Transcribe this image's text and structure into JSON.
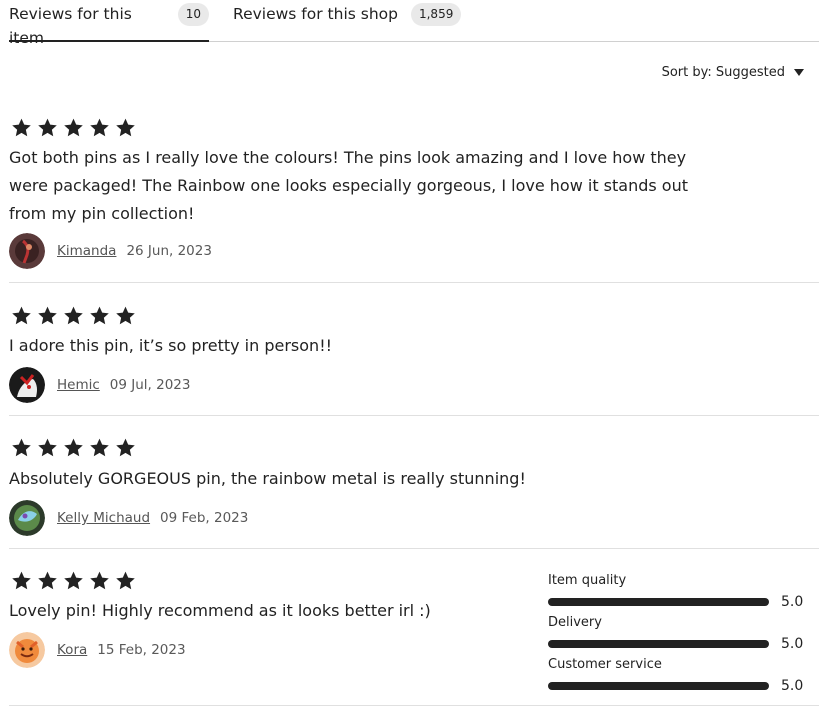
{
  "tabs": [
    {
      "label": "Reviews for this item",
      "count": "10",
      "active": true
    },
    {
      "label": "Reviews for this shop",
      "count": "1,859",
      "active": false
    }
  ],
  "sort": {
    "label": "Sort by: Suggested"
  },
  "reviews": [
    {
      "rating": 5,
      "text": "Got both pins as I really love the colours! The pins look amazing and I love how they were packaged! The Rainbow one looks especially gorgeous, I love how it stands out from my pin collection!",
      "author": "Kimanda",
      "date": "26 Jun, 2023",
      "avatar_icon": "avatar-image"
    },
    {
      "rating": 5,
      "text": "I adore this pin, it’s so pretty in person!!",
      "author": "Hemic",
      "date": "09 Jul, 2023",
      "avatar_icon": "avatar-image"
    },
    {
      "rating": 5,
      "text": "Absolutely GORGEOUS pin, the rainbow metal is really stunning!",
      "author": "Kelly Michaud",
      "date": "09 Feb, 2023",
      "avatar_icon": "avatar-image"
    },
    {
      "rating": 5,
      "text": "Lovely pin! Highly recommend as it looks better irl :)",
      "author": "Kora",
      "date": "15 Feb, 2023",
      "avatar_icon": "avatar-image"
    }
  ],
  "rating_breakdown": [
    {
      "label": "Item quality",
      "value": "5.0",
      "fraction": 1.0
    },
    {
      "label": "Delivery",
      "value": "5.0",
      "fraction": 1.0
    },
    {
      "label": "Customer service",
      "value": "5.0",
      "fraction": 1.0
    }
  ],
  "colors": {
    "text": "#222222",
    "muted": "#595959",
    "divider": "#e0e0e0",
    "badge": "#e9e9e9"
  }
}
